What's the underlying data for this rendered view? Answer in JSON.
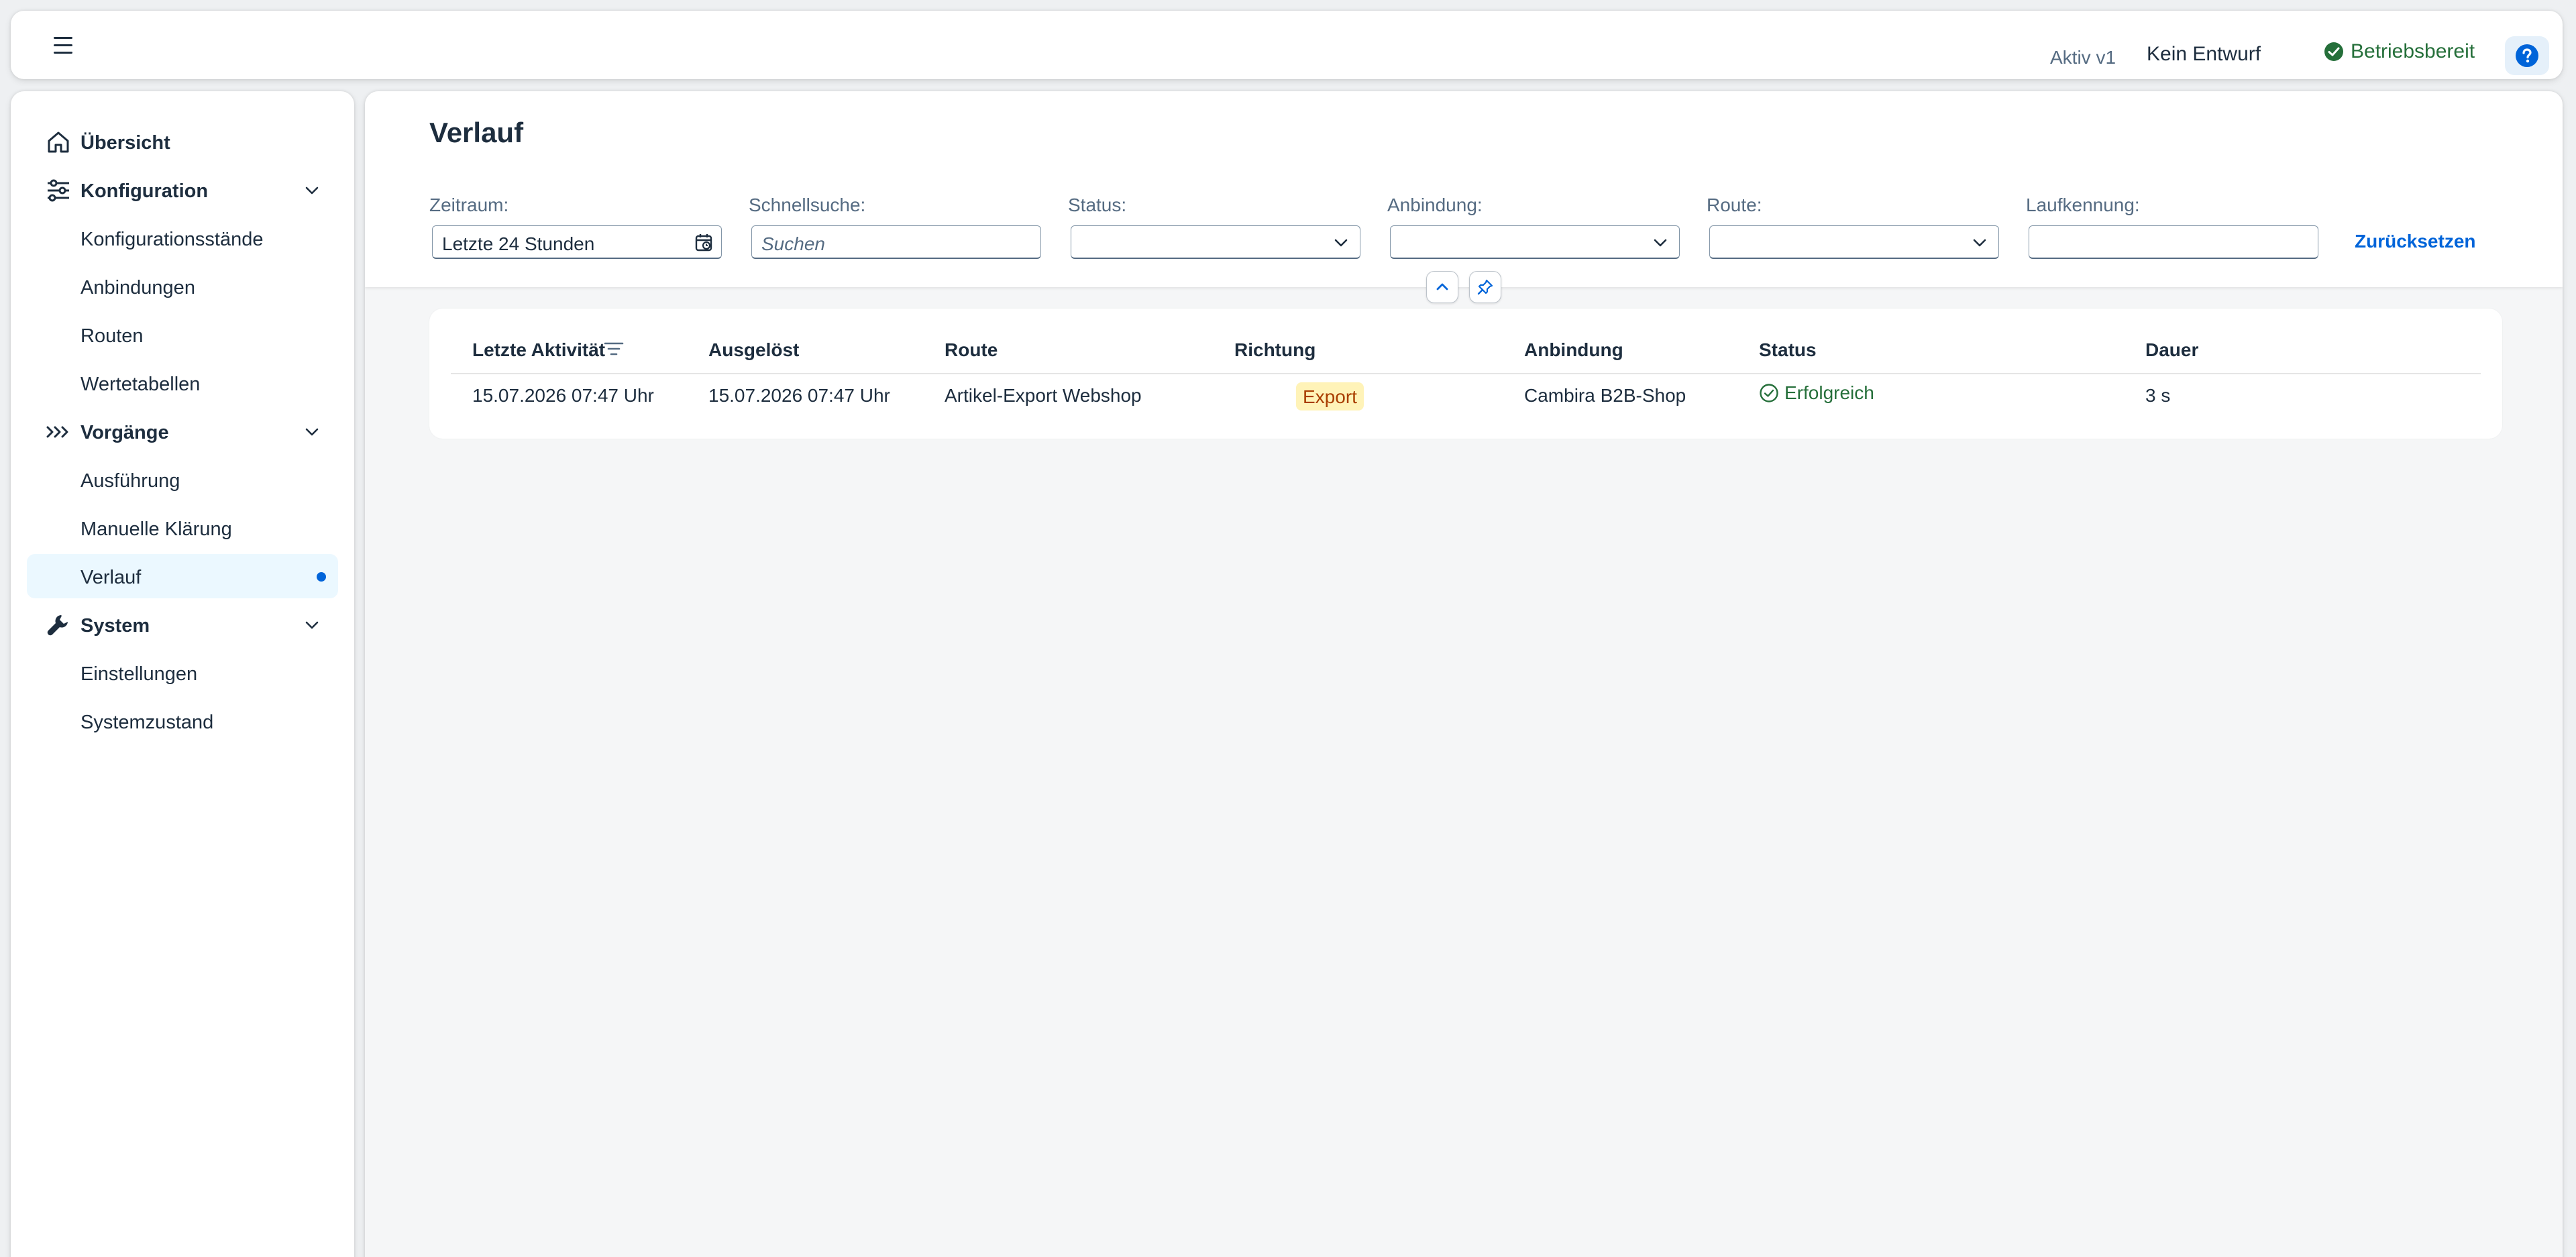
{
  "shell": {
    "menu_icon": "hamburger-menu-icon",
    "version": "Aktiv v1",
    "draft": "Kein Entwurf",
    "status": "Betriebsbereit",
    "status_icon": "success-check-icon",
    "help_icon": "help-question-icon"
  },
  "nav": {
    "items": [
      {
        "label": "Übersicht",
        "type": "group",
        "icon": "home-icon"
      },
      {
        "label": "Konfiguration",
        "type": "group",
        "icon": "sliders-icon",
        "expanded": true
      },
      {
        "label": "Konfigurationsstände",
        "type": "child"
      },
      {
        "label": "Anbindungen",
        "type": "child"
      },
      {
        "label": "Routen",
        "type": "child"
      },
      {
        "label": "Wertetabellen",
        "type": "child"
      },
      {
        "label": "Vorgänge",
        "type": "group",
        "icon": "chevrons-right-icon",
        "expanded": true
      },
      {
        "label": "Ausführung",
        "type": "child"
      },
      {
        "label": "Manuelle Klärung",
        "type": "child"
      },
      {
        "label": "Verlauf",
        "type": "child",
        "selected": true
      },
      {
        "label": "System",
        "type": "group",
        "icon": "wrench-icon",
        "expanded": true
      },
      {
        "label": "Einstellungen",
        "type": "child"
      },
      {
        "label": "Systemzustand",
        "type": "child"
      }
    ]
  },
  "page": {
    "title": "Verlauf"
  },
  "filters": {
    "zeitraum": {
      "label": "Zeitraum:",
      "value": "Letzte 24 Stunden"
    },
    "schnellsuche": {
      "label": "Schnellsuche:",
      "placeholder": "Suchen",
      "value": ""
    },
    "status": {
      "label": "Status:",
      "value": ""
    },
    "anbindung": {
      "label": "Anbindung:",
      "value": ""
    },
    "route": {
      "label": "Route:",
      "value": ""
    },
    "laufkennung": {
      "label": "Laufkennung:",
      "value": ""
    },
    "reset_label": "Zurücksetzen"
  },
  "table": {
    "columns": [
      "Letzte Aktivität",
      "Ausgelöst",
      "Route",
      "Richtung",
      "Anbindung",
      "Status",
      "Dauer"
    ],
    "sorted_column": "Letzte Aktivität",
    "rows": [
      {
        "letzte_aktivitaet": "15.07.2026 07:47 Uhr",
        "ausgeloest": "15.07.2026 07:47 Uhr",
        "route": "Artikel-Export Webshop",
        "richtung": "Export",
        "anbindung": "Cambira B2B-Shop",
        "status": "Erfolgreich",
        "dauer": "3 s"
      }
    ]
  },
  "colors": {
    "accent": "#0064d9",
    "success": "#256f3a",
    "export_badge_bg": "#fff3b8",
    "export_badge_text": "#a93e00",
    "selected_nav_bg": "#ebf8ff"
  }
}
